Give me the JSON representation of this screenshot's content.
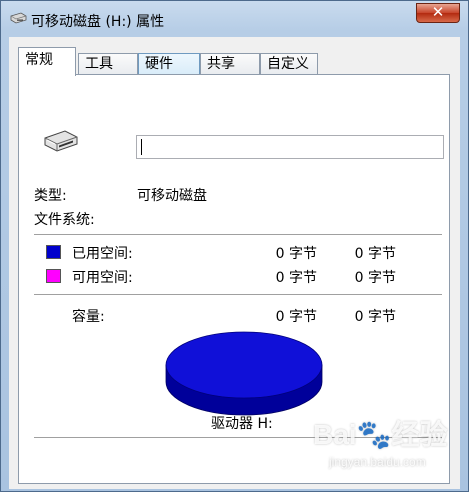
{
  "window": {
    "title": "可移动磁盘 (H:) 属性",
    "close_glyph": "✕",
    "icon": "removable-drive-icon"
  },
  "tabs": [
    {
      "label": "常规",
      "active": true
    },
    {
      "label": "工具",
      "active": false
    },
    {
      "label": "硬件",
      "active": false
    },
    {
      "label": "共享",
      "active": false
    },
    {
      "label": "自定义",
      "active": false
    }
  ],
  "general": {
    "drive_icon": "removable-drive-icon",
    "name_value": "",
    "type_label": "类型:",
    "type_value": "可移动磁盘",
    "filesystem_label": "文件系统:",
    "filesystem_value": "",
    "used": {
      "label": "已用空间:",
      "bytes": "0 字节",
      "size": "0 字节",
      "color": "#0000cc"
    },
    "free": {
      "label": "可用空间:",
      "bytes": "0 字节",
      "size": "0 字节",
      "color": "#ff00ff"
    },
    "capacity": {
      "label": "容量:",
      "bytes": "0 字节",
      "size": "0 字节"
    },
    "pie_color": "#1010d8",
    "drive_label": "驱动器 H:"
  },
  "watermark": {
    "brand": "Bai",
    "brand_suffix": "经验",
    "url": "jingyan.baidu.com"
  }
}
